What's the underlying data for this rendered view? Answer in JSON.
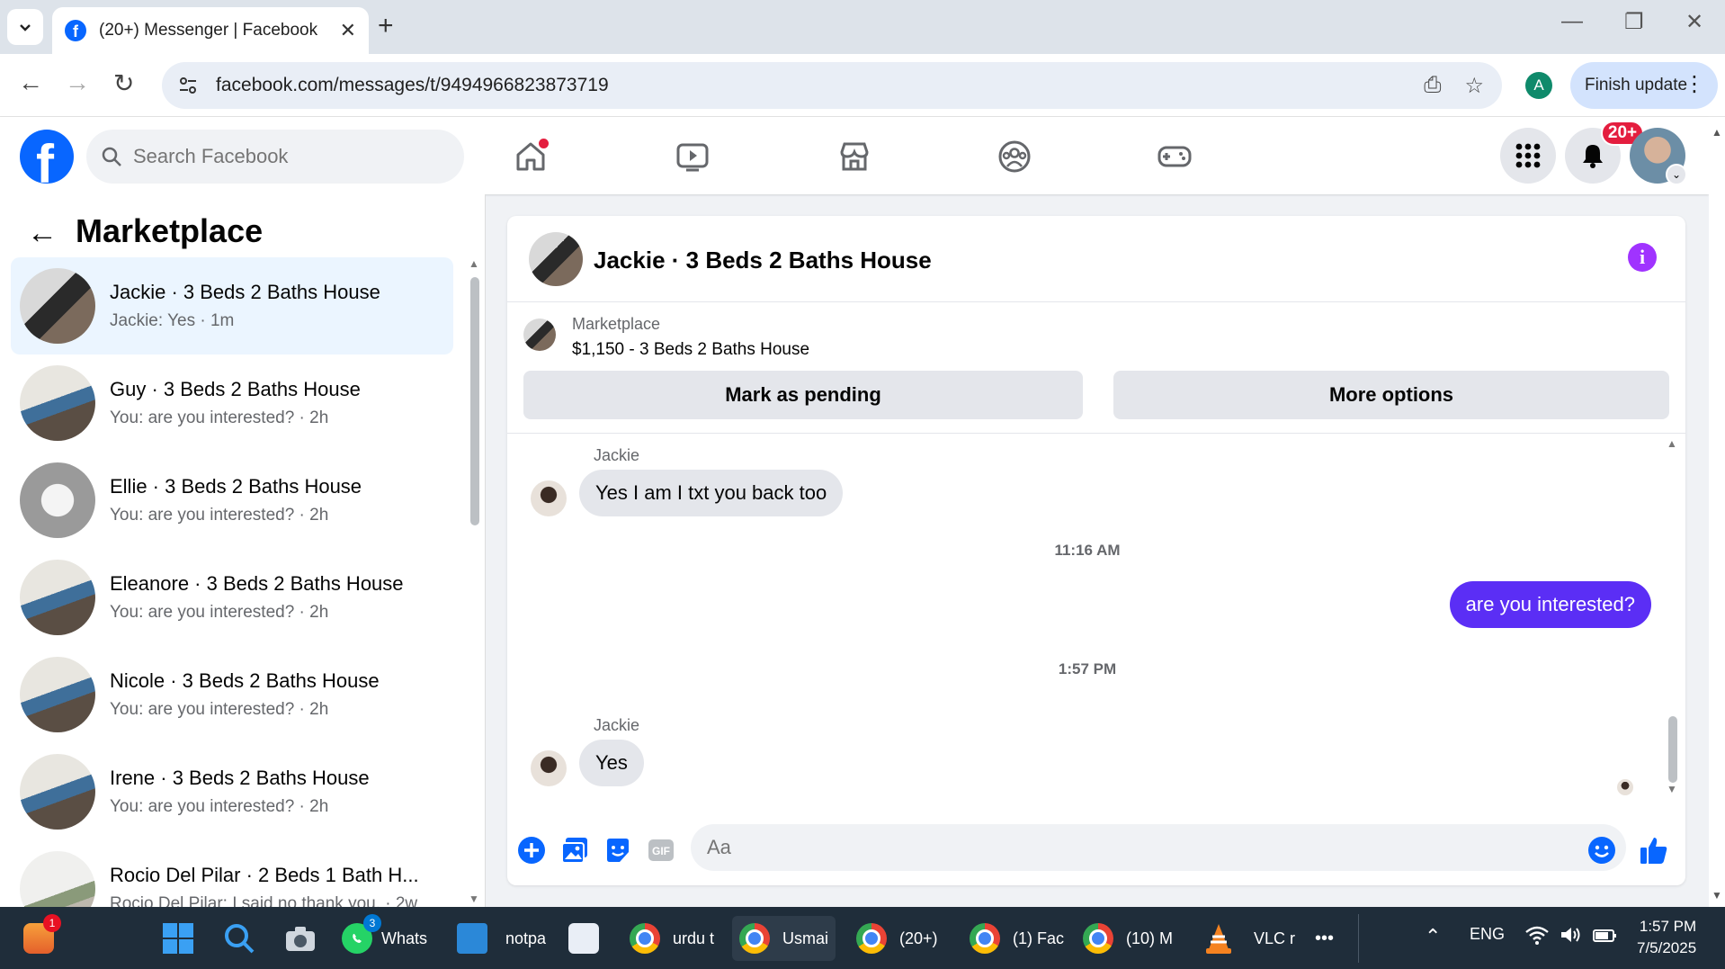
{
  "browser": {
    "tab_title": "(20+) Messenger | Facebook",
    "url": "facebook.com/messages/t/9494966823873719",
    "profile_letter": "A",
    "finish_update_label": "Finish update"
  },
  "fb": {
    "search_placeholder": "Search Facebook",
    "notification_badge": "20+",
    "brand_color": "#0866ff"
  },
  "sidebar": {
    "title": "Marketplace",
    "conversations": [
      {
        "name": "Jackie · 3 Beds 2 Baths House",
        "sub": "Jackie: Yes · 1m",
        "active": true
      },
      {
        "name": "Guy · 3 Beds 2 Baths House",
        "sub": "You: are you interested? · 2h"
      },
      {
        "name": "Ellie · 3 Beds 2 Baths House",
        "sub": "You: are you interested? · 2h"
      },
      {
        "name": "Eleanore · 3 Beds 2 Baths House",
        "sub": "You: are you interested? · 2h"
      },
      {
        "name": "Nicole · 3 Beds 2 Baths House",
        "sub": "You: are you interested? · 2h"
      },
      {
        "name": "Irene · 3 Beds 2 Baths House",
        "sub": "You: are you interested? · 2h"
      },
      {
        "name": "Rocio Del Pilar · 2 Beds 1 Bath H...",
        "sub": "Rocio Del Pilar: I said no thank you. · 2w"
      }
    ]
  },
  "chat": {
    "title": "Jackie · 3 Beds 2 Baths House",
    "listing_label": "Marketplace",
    "listing_item": "$1,150 - 3 Beds 2 Baths House",
    "mark_pending_label": "Mark as pending",
    "more_options_label": "More options",
    "messages": {
      "m1_sender": "Jackie",
      "m1_text": "Yes I am I txt you back too",
      "time1": "11:16 AM",
      "m2_text": "are you interested?",
      "time2": "1:57 PM",
      "m3_sender": "Jackie",
      "m3_text": "Yes"
    },
    "composer_placeholder": "Aa",
    "accent_color": "#5b2ef5"
  },
  "taskbar": {
    "start_badge": "1",
    "whatsapp_label": "Whats",
    "whatsapp_badge": "3",
    "notepad_label": "notpa",
    "apps": [
      {
        "label": "urdu t",
        "active": false
      },
      {
        "label": "Usmai",
        "active": true
      },
      {
        "label": "(20+)",
        "active": false
      },
      {
        "label": "(1) Fac",
        "active": false
      },
      {
        "label": "(10) M",
        "active": false
      }
    ],
    "vlc_label": "VLC r",
    "more": "•••",
    "lang": "ENG",
    "time": "1:57 PM",
    "date": "7/5/2025"
  }
}
